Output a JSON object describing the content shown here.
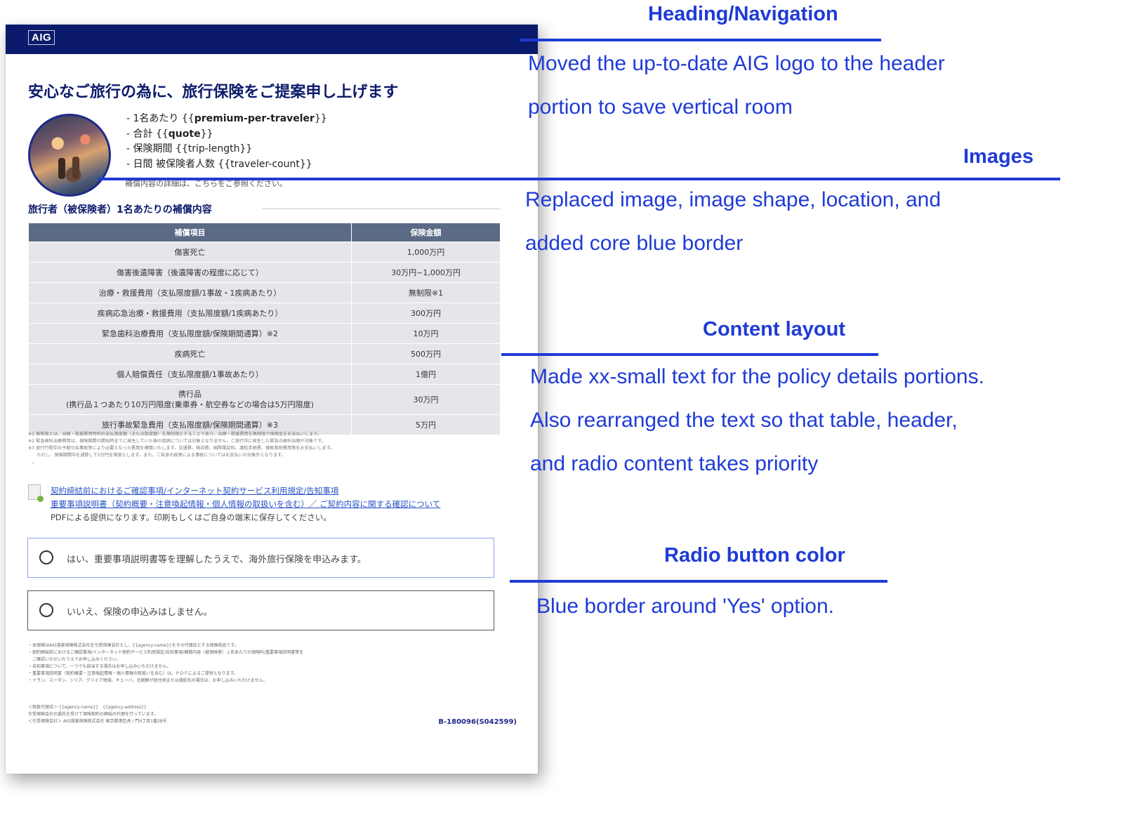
{
  "document": {
    "logo_text": "AIG",
    "title": "安心なご旅行の為に、旅行保険をご提案申し上げます",
    "bullets": [
      {
        "prefix": "- 1名あたり {{",
        "strong": "premium-per-traveler",
        "suffix": "}}"
      },
      {
        "prefix": "- 合計 {{",
        "strong": "quote",
        "suffix": "}}"
      },
      {
        "prefix": "- 保険期間 {{trip-length}}",
        "strong": "",
        "suffix": ""
      },
      {
        "prefix": "- 日間 被保険者人数 {{traveler-count}}",
        "strong": "",
        "suffix": ""
      }
    ],
    "partial_line": "補償内容の詳細は、こちらをご参照ください。",
    "section_title": "旅行者（被保険者）1名あたりの補償内容",
    "table": {
      "headers": [
        "補償項目",
        "保険金額"
      ],
      "rows": [
        [
          "傷害死亡",
          "1,000万円"
        ],
        [
          "傷害後遺障害（後遺障害の程度に応じて）",
          "30万円~1,000万円"
        ],
        [
          "治療・救援費用（支払限度額/1事故・1疾病あたり）",
          "無制限※1"
        ],
        [
          "疾病応急治療・救援費用（支払限度額/1疾病あたり）",
          "300万円"
        ],
        [
          "緊急歯科治療費用（支払限度額/保険期間通算）※2",
          "10万円"
        ],
        [
          "疾病死亡",
          "500万円"
        ],
        [
          "個人賠償責任（支払限度額/1事故あたり）",
          "1億円"
        ],
        [
          "携行品\n(携行品１つあたり10万円限度(乗車券・航空券などの場合は5万円限度)",
          "30万円"
        ],
        [
          "旅行事故緊急費用（支払限度額/保険期間通算）※3",
          "5万円"
        ]
      ]
    },
    "notes": [
      "※1 無制限とは、治療・救援費用特約の支払限度額（または限度額）を無制限とすることであり、治療・救援費用を無制限で保険金をお支払いします。",
      "※2 緊急歯科治療費用は、保険期間の開始時までに発生していた歯の疾病については対象となりません。ご旅行中に発生した緊急の歯科治療が対象です。",
      "※3 旅行行程中の予期せぬ事故等により必要となった費用を補償いたします。交通費、宿泊費、国際電話料、渡航手続費、捜索救助費用等をお支払いします。",
      "　　ただし、保険期間中を通算して5万円を限度とします。また、ご自身の故意による事故についてはお支払いの対象外となります。",
      "　。"
    ],
    "links": [
      "契約締結前におけるご確認事項/インターネット契約サービス利用規定/告知事項",
      "重要事項説明書（契約概要・注意喚起情報・個人情報の取扱いを含む）／ ご契約内容に関する確認について"
    ],
    "pdf_note": "PDFによる提供になります。印刷もしくはご自身の端末に保存してください。",
    "radio_yes": "はい、重要事項説明書等を理解したうえで、海外旅行保険を申込みます。",
    "radio_no": "いいえ、保険の申込みはしません。",
    "fine_print": [
      "・本保険はAIG損害保険株式会社を引受保険会社とし、{{agency-name}}をその代理店とする保険商品です。",
      "・契約締結前におけるご確認事項/インターネット契約サービス利用規定/告知事項/補償内容（被保険者）１名あたりの保険料/重要事項説明書等を",
      "　ご確認いただいたうえでお申し込みください。",
      "・告知事項について、一つでも該当する場合はお申し込みいただけません。",
      "・重要事項説明書（契約概要・注意喚起情報・個人情報の取扱いを含む）は、ＰＤＦによるご提供となります。",
      "・イラン、スーダン、シリア、クリミア地域、キューバ、北朝鮮が居住地または渡航先の場合は、お申し込みいただけません。"
    ],
    "agency": [
      "＜取扱代理店＞ {{agency-name}}　{{agency-address}}",
      "引受保険会社の委託を受けて保険契約の締結の代理を行っています。",
      "＜引受保険会社＞ AIG損害保険株式会社 東京都港区虎ノ門4丁目1番28号"
    ],
    "doc_code": "B-180096(S042599)"
  },
  "annotations": [
    {
      "heading": "Heading/Navigation",
      "lines": [
        "Moved the up-to-date AIG logo to the header",
        "portion to save vertical room"
      ]
    },
    {
      "heading": "Images",
      "lines": [
        "Replaced image, image shape, location, and",
        "added core blue border"
      ]
    },
    {
      "heading": "Content layout",
      "lines": [
        "Made xx-small text for the policy details portions.",
        "Also rearranged the text so that table, header,",
        "and radio content takes priority"
      ]
    },
    {
      "heading": "Radio button color",
      "lines": [
        "Blue border around 'Yes' option."
      ]
    }
  ],
  "colors": {
    "accent": "#1f3bd6",
    "header_navy": "#0c1a6b",
    "table_header": "#5b6b86",
    "table_cell": "#e4e6ea"
  }
}
